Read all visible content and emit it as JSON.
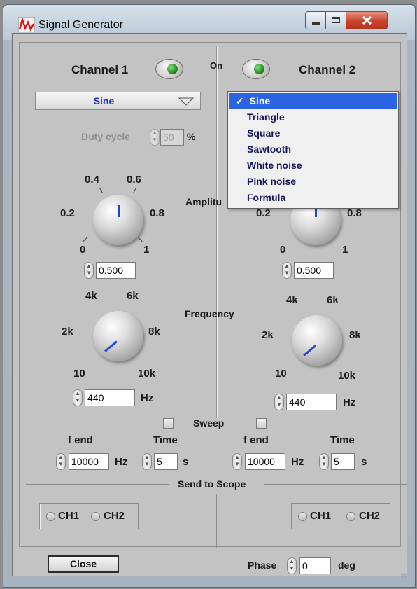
{
  "window": {
    "title": "Signal Generator",
    "app_icon": "signal-wave-icon"
  },
  "channel1": {
    "label": "Channel 1",
    "waveform": "Sine",
    "duty_cycle_label": "Duty cycle",
    "duty_value": "50",
    "duty_unit": "%",
    "amplitude_value": "0.500",
    "frequency_value": "440",
    "freq_unit": "Hz",
    "amp_scale": [
      "0.2",
      "0.4",
      "0.6",
      "0.8",
      "0",
      "1"
    ],
    "freq_scale": [
      "2k",
      "4k",
      "6k",
      "8k",
      "10",
      "10k"
    ],
    "f_end_label": "f end",
    "f_end_value": "10000",
    "f_end_unit": "Hz",
    "time_label": "Time",
    "time_value": "5",
    "time_unit": "s"
  },
  "channel2": {
    "label": "Channel 2",
    "amplitude_value": "0.500",
    "frequency_value": "440",
    "freq_unit": "Hz",
    "amp_scale": [
      "0.2",
      "0.8",
      "0",
      "1"
    ],
    "freq_scale": [
      "2k",
      "4k",
      "6k",
      "8k",
      "10",
      "10k"
    ],
    "f_end_label": "f end",
    "f_end_value": "10000",
    "f_end_unit": "Hz",
    "time_label": "Time",
    "time_value": "5",
    "time_unit": "s"
  },
  "shared": {
    "on_label": "On",
    "amplitude_label": "Amplitu",
    "frequency_label": "Frequency",
    "sweep_label": "Sweep",
    "send_to_scope_label": "Send to Scope",
    "ch1": "CH1",
    "ch2": "CH2",
    "close_label": "Close",
    "phase_label": "Phase",
    "phase_value": "0",
    "phase_unit": "deg"
  },
  "waveform_menu": {
    "check": "✓",
    "options": [
      "Sine",
      "Triangle",
      "Square",
      "Sawtooth",
      "White noise",
      "Pink noise",
      "Formula"
    ],
    "selected": "Sine"
  },
  "colors": {
    "accent": "#2b63e3",
    "knob_pointer": "#2046d8",
    "led_on": "#1a7d1a",
    "close_button": "#c8452c"
  }
}
